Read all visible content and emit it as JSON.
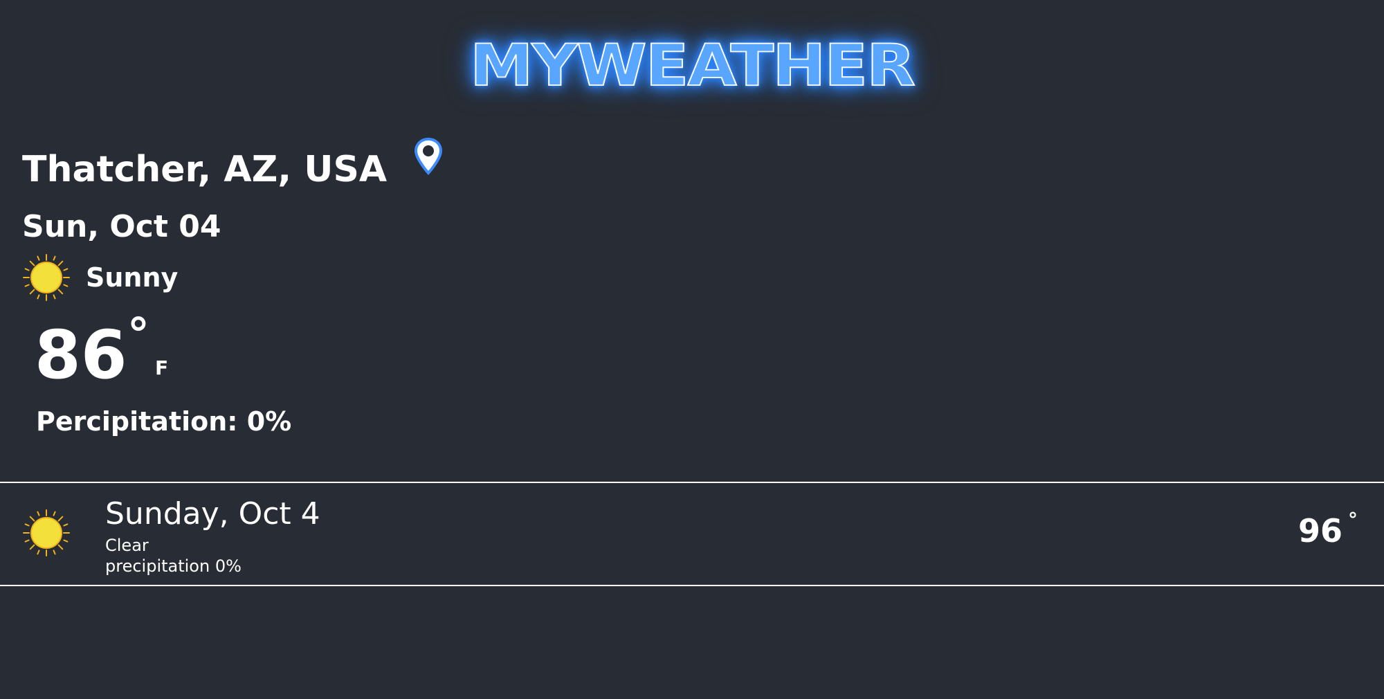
{
  "header": {
    "logo_text": "MYWEATHER"
  },
  "current": {
    "location": "Thatcher, AZ, USA",
    "location_icon": "map-pin-icon",
    "date": "Sun, Oct 04",
    "condition_icon": "sun-icon",
    "condition": "Sunny",
    "temperature": "86",
    "degree_symbol": "°",
    "unit": "F",
    "precipitation": "Percipitation: 0%"
  },
  "forecast": [
    {
      "icon": "sun-icon",
      "day": "Sunday, Oct 4",
      "condition": "Clear",
      "precipitation": "precipitation 0%",
      "temperature": "96",
      "degree_symbol": "°"
    }
  ],
  "colors": {
    "background": "#282c34",
    "text": "#ffffff",
    "logo_glow": "#2f86ff",
    "pin": "#58a6ff",
    "sun": "#f3e03b",
    "sun_rays": "#f2b31b"
  }
}
